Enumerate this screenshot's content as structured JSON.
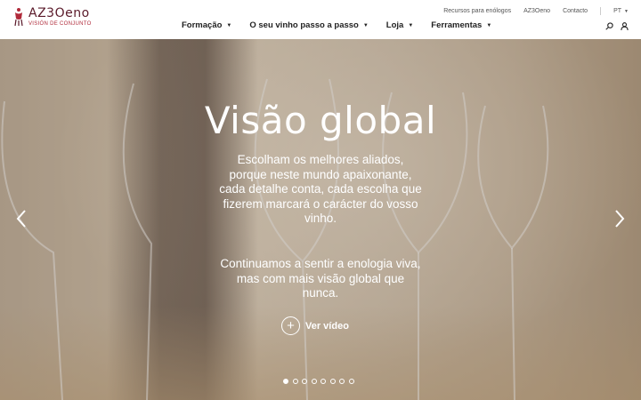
{
  "brand": {
    "name": "AZ3Oeno",
    "tagline": "VISIÓN DE CONJUNTO",
    "colors": {
      "primary": "#5a1a2a",
      "accent": "#b02a3a"
    }
  },
  "utility_nav": {
    "items": [
      "Recursos para enólogos",
      "AZ3Oeno",
      "Contacto"
    ],
    "language": "PT"
  },
  "main_nav": {
    "items": [
      {
        "label": "Formação"
      },
      {
        "label": "O seu vinho passo a passo"
      },
      {
        "label": "Loja"
      },
      {
        "label": "Ferramentas"
      }
    ]
  },
  "header_icons": [
    "search-icon",
    "user-icon"
  ],
  "hero": {
    "title": "Visão global",
    "paragraph1": "Escolham os melhores aliados, porque neste mundo apaixonante, cada detalhe conta, cada escolha que fizerem marcará o carácter do vosso vinho.",
    "paragraph2": "Continuamos a sentir a enologia viva, mas com mais visão global que nunca.",
    "video_label": "Ver vídeo",
    "slides_total": 8,
    "active_slide": 1
  }
}
